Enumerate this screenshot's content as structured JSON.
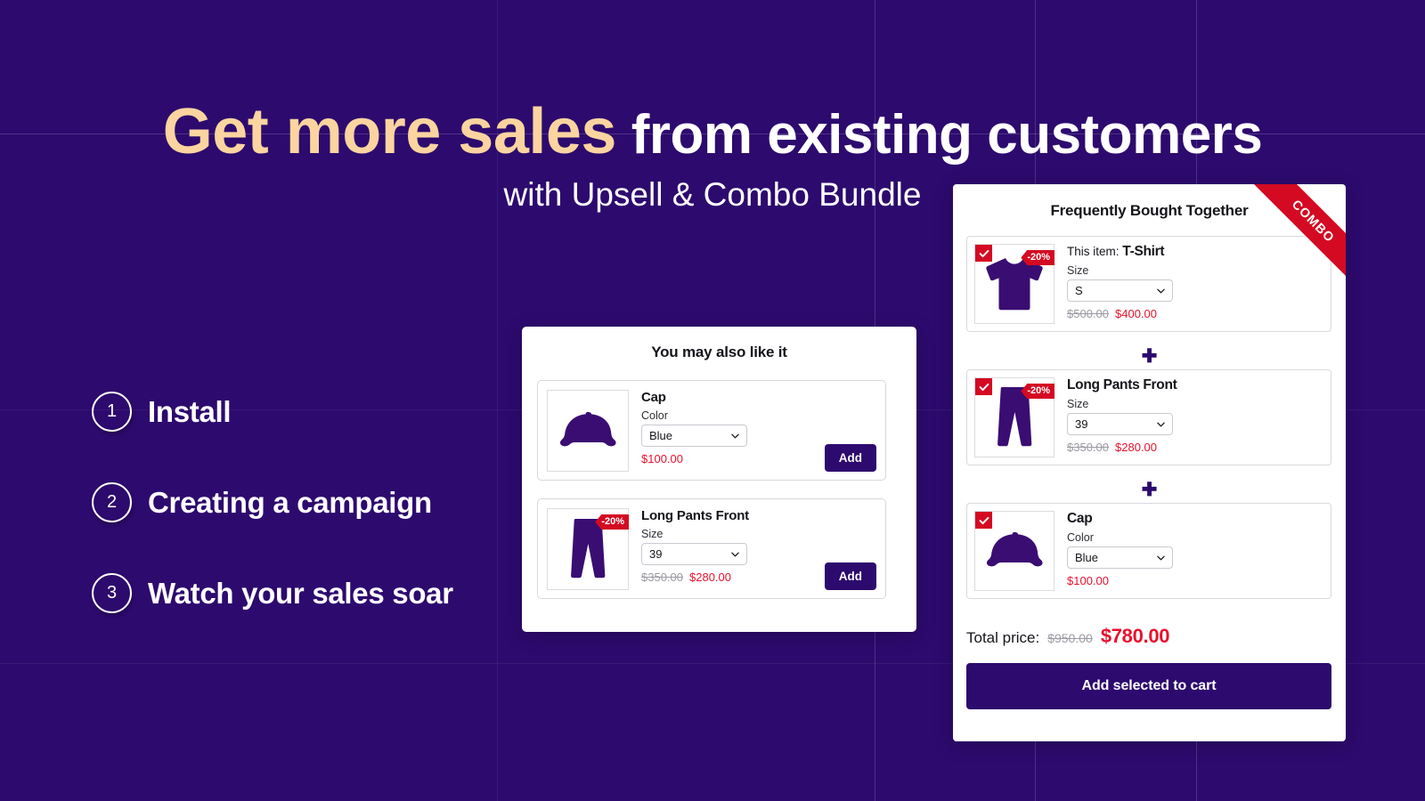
{
  "theme": {
    "bg_purple": "#2d0a6e",
    "accent_cream": "#fbd4a0",
    "badge_red": "#d40a22",
    "price_red": "#e8112d"
  },
  "hero": {
    "headline_accent": "Get more sales",
    "headline_rest": " from existing customers",
    "subheadline": "with Upsell & Combo Bundle"
  },
  "steps": [
    {
      "num": "1",
      "label": "Install"
    },
    {
      "num": "2",
      "label": "Creating a campaign"
    },
    {
      "num": "3",
      "label": "Watch your sales soar"
    }
  ],
  "upsell": {
    "title": "You may also like it",
    "items": [
      {
        "name": "Cap",
        "option_label": "Color",
        "option_value": "Blue",
        "price_old": "",
        "price_new": "$100.00",
        "discount": "",
        "add_label": "Add",
        "image": "cap"
      },
      {
        "name": "Long Pants Front",
        "option_label": "Size",
        "option_value": "39",
        "price_old": "$350.00",
        "price_new": "$280.00",
        "discount": "-20%",
        "add_label": "Add",
        "image": "pants"
      }
    ]
  },
  "bundle": {
    "title": "Frequently Bought Together",
    "ribbon": "COMBO",
    "plus_separator": "✚",
    "items": [
      {
        "prefix": "This item: ",
        "name": "T-Shirt",
        "option_label": "Size",
        "option_value": "S",
        "price_old": "$500.00",
        "price_new": "$400.00",
        "discount": "-20%",
        "checked": true,
        "image": "tshirt"
      },
      {
        "prefix": "",
        "name": "Long Pants Front",
        "option_label": "Size",
        "option_value": "39",
        "price_old": "$350.00",
        "price_new": "$280.00",
        "discount": "-20%",
        "checked": true,
        "image": "pants"
      },
      {
        "prefix": "",
        "name": "Cap",
        "option_label": "Color",
        "option_value": "Blue",
        "price_old": "",
        "price_new": "$100.00",
        "discount": "",
        "checked": true,
        "image": "cap"
      }
    ],
    "total_label": "Total price:",
    "total_old": "$950.00",
    "total_new": "$780.00",
    "cta_label": "Add selected to cart"
  }
}
